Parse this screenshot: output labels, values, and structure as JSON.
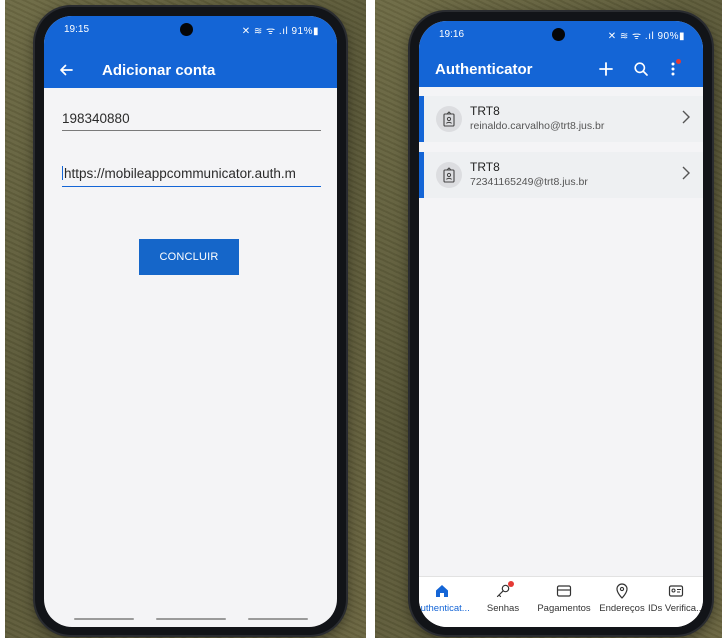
{
  "left_screen": {
    "status": {
      "time": "19:15",
      "icons": "✕ ≋ ᯤ .ıl 91%▮"
    },
    "header": {
      "title": "Adicionar conta"
    },
    "form": {
      "field1_value": "198340880",
      "field2_value": "https://mobileappcommunicator.auth.m"
    },
    "submit_label": "CONCLUIR"
  },
  "right_screen": {
    "status": {
      "time": "19:16",
      "icons": "✕ ≋ ᯤ .ıl 90%▮"
    },
    "header": {
      "title": "Authenticator"
    },
    "accounts": [
      {
        "name": "TRT8",
        "email": "reinaldo.carvalho@trt8.jus.br"
      },
      {
        "name": "TRT8",
        "email": "72341165249@trt8.jus.br"
      }
    ],
    "bottom_nav": [
      {
        "label": "Authenticat...",
        "icon": "home-icon"
      },
      {
        "label": "Senhas",
        "icon": "key-icon"
      },
      {
        "label": "Pagamentos",
        "icon": "card-icon"
      },
      {
        "label": "Endereços",
        "icon": "location-pin-icon"
      },
      {
        "label": "IDs Verifica...",
        "icon": "id-card-icon"
      }
    ]
  },
  "colors": {
    "brand_blue": "#1465d6",
    "alert_red": "#e53935"
  }
}
